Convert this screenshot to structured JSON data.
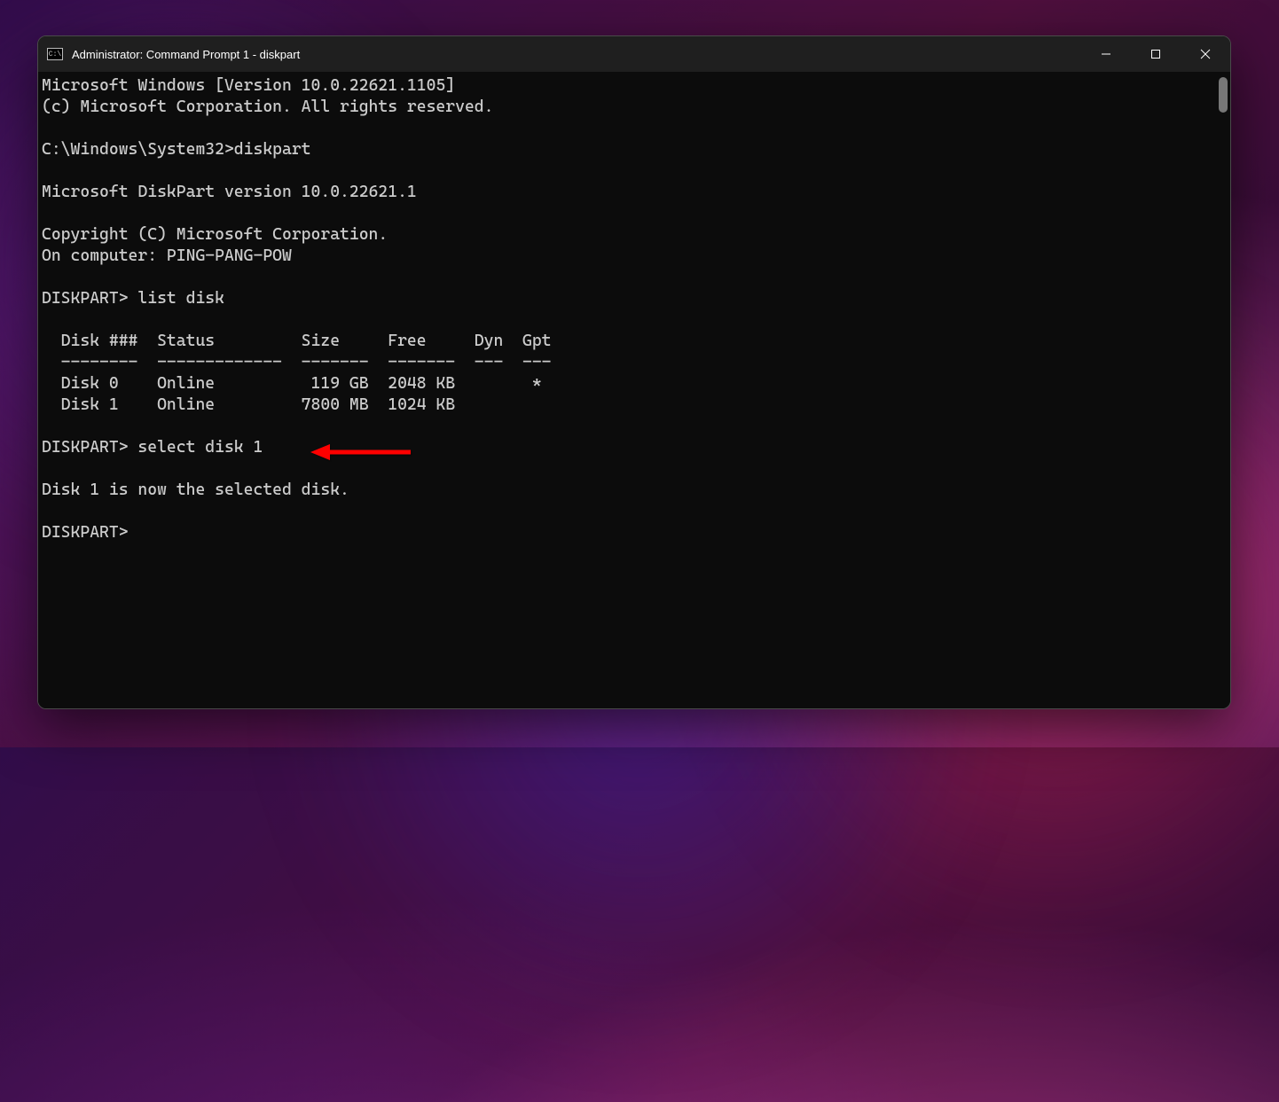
{
  "window": {
    "title": "Administrator: Command Prompt 1 - diskpart"
  },
  "terminal": {
    "line_os": "Microsoft Windows [Version 10.0.22621.1105]",
    "line_copyright_os": "(c) Microsoft Corporation. All rights reserved.",
    "prompt_path": "C:\\Windows\\System32>",
    "cmd_diskpart": "diskpart",
    "diskpart_version": "Microsoft DiskPart version 10.0.22621.1",
    "diskpart_copyright": "Copyright (C) Microsoft Corporation.",
    "computer_line": "On computer: PING-PANG-POW",
    "diskpart_prompt": "DISKPART>",
    "cmd_list": "list disk",
    "table_header": "  Disk ###  Status         Size     Free     Dyn  Gpt",
    "table_divider": "  --------  -------------  -------  -------  ---  ---",
    "table_row0": "  Disk 0    Online          119 GB  2048 KB        *",
    "table_row1": "  Disk 1    Online         7800 MB  1024 KB",
    "cmd_select": "select disk 1",
    "result_line": "Disk 1 is now the selected disk."
  }
}
